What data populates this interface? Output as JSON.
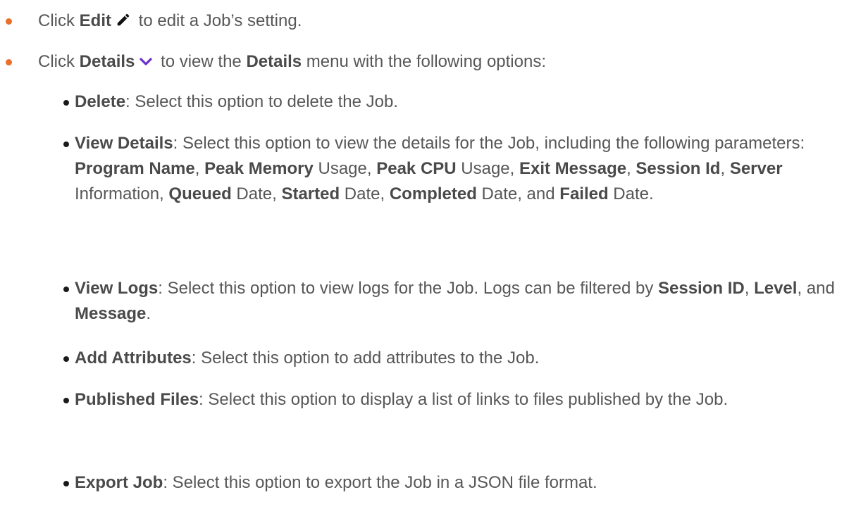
{
  "edit_item": {
    "prefix": "Click ",
    "bold": "Edit",
    "suffix": " to edit a Job’s setting."
  },
  "details_item": {
    "prefix": "Click ",
    "bold": "Details",
    "middle": " to view the ",
    "bold2": "Details",
    "suffix": " menu with the following options:"
  },
  "options": {
    "delete": {
      "name": "Delete",
      "desc": ": Select this option to delete the Job."
    },
    "view_details": {
      "name": "View Details",
      "desc": ": Select this option to view the details for the Job, including the following parameters: ",
      "p1": "Program Name",
      "s1": ", ",
      "p2": "Peak Memory",
      "s2": " Usage, ",
      "p3": "Peak CPU",
      "s3": " Usage, ",
      "p4": "Exit Message",
      "s4": ", ",
      "p5": "Session Id",
      "s5": ", ",
      "p6": "Server",
      "s6": " Information, ",
      "p7": "Queued",
      "s7": " Date, ",
      "p8": "Started",
      "s8": " Date, ",
      "p9": "Completed",
      "s9": " Date, and ",
      "p10": "Failed",
      "s10": " Date."
    },
    "view_logs": {
      "name": "View Logs",
      "desc": ": Select this option to view logs for the Job. Logs can be filtered by ",
      "f1": "Session ID",
      "s1": ", ",
      "f2": "Level",
      "s2": ", and ",
      "f3": "Message",
      "s3": "."
    },
    "add_attributes": {
      "name": "Add Attributes",
      "desc": ": Select this option to add attributes to the Job."
    },
    "published_files": {
      "name": "Published Files",
      "desc": ": Select this option to display a list of links to files published by the Job."
    },
    "export_job": {
      "name": "Export Job",
      "desc": ": Select this option to export the Job in a JSON file format."
    }
  },
  "colors": {
    "orange_bullet": "#e8702a",
    "icon_purple": "#6a2fd0",
    "text": "#575757"
  },
  "icons": {
    "edit": "pencil-icon",
    "details": "chevron-down-icon"
  }
}
